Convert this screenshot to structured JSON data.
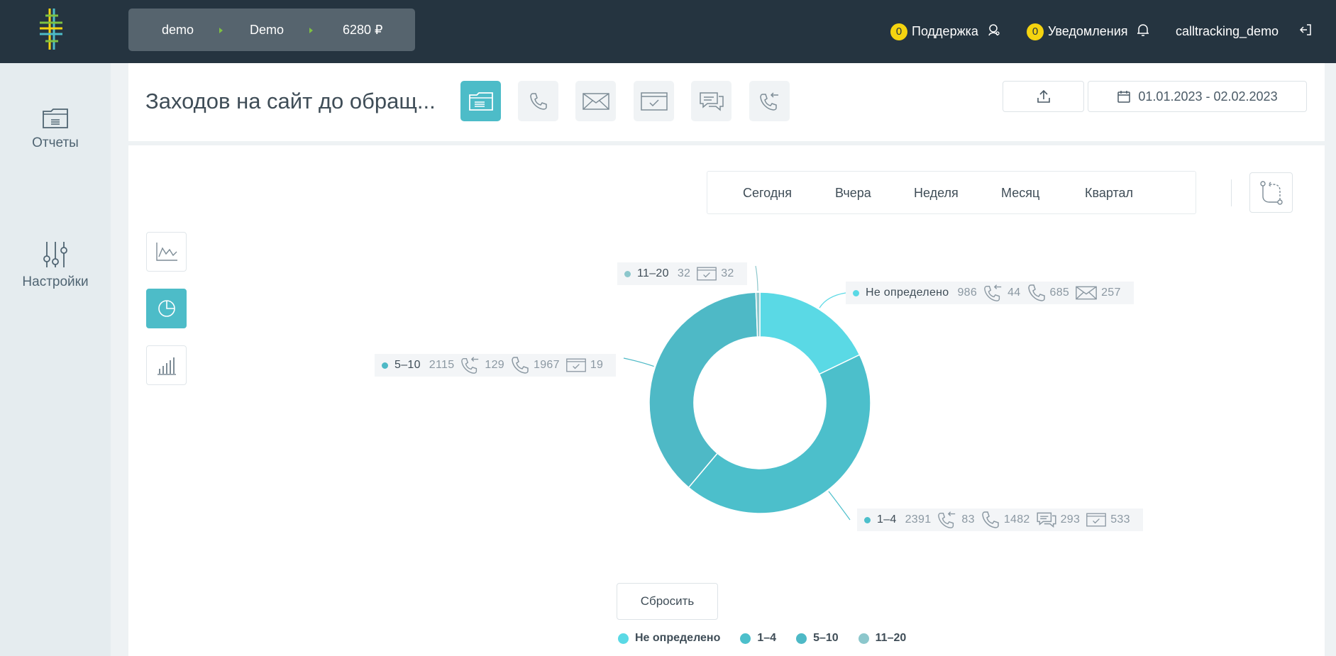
{
  "topbar": {
    "breadcrumbs": [
      "demo",
      "Demo",
      "6280 ₽"
    ],
    "support": {
      "count": "0",
      "label": "Поддержка"
    },
    "notifications": {
      "count": "0",
      "label": "Уведомления"
    },
    "username": "calltracking_demo",
    "colors": {
      "bg": "#253440",
      "badge": "#f5d40f",
      "crumb_sep": "#7ec142"
    }
  },
  "sidebar": {
    "items": [
      {
        "label": "Отчеты",
        "icon": "folder-icon"
      },
      {
        "label": "Настройки",
        "icon": "sliders-icon"
      }
    ]
  },
  "header": {
    "title": "Заходов на сайт до обращ...",
    "type_buttons": [
      "all-requests-icon",
      "phone-icon",
      "mail-icon",
      "form-icon",
      "chat-icon",
      "callback-icon"
    ],
    "date_range": "01.01.2023 - 02.02.2023"
  },
  "periods": [
    "Сегодня",
    "Вчера",
    "Неделя",
    "Месяц",
    "Квартал"
  ],
  "view_buttons": [
    "line-chart-icon",
    "pie-chart-icon",
    "bar-chart-icon"
  ],
  "reset_label": "Сбросить",
  "chart_data": {
    "type": "pie",
    "categories": [
      "Не определено",
      "1–4",
      "5–10",
      "11–20"
    ],
    "values": [
      986,
      2391,
      2115,
      32
    ],
    "colors": [
      "#5ad9e5",
      "#4cbfcb",
      "#4eb9c6",
      "#8cc7cc"
    ],
    "breakdowns": [
      {
        "name": "Не определено",
        "total": "986",
        "items": [
          {
            "icon": "callback-icon",
            "value": "44"
          },
          {
            "icon": "phone-icon",
            "value": "685"
          },
          {
            "icon": "mail-icon",
            "value": "257"
          }
        ]
      },
      {
        "name": "1–4",
        "total": "2391",
        "items": [
          {
            "icon": "callback-icon",
            "value": "83"
          },
          {
            "icon": "phone-icon",
            "value": "1482"
          },
          {
            "icon": "chat-icon",
            "value": "293"
          },
          {
            "icon": "form-icon",
            "value": "533"
          }
        ]
      },
      {
        "name": "5–10",
        "total": "2115",
        "items": [
          {
            "icon": "callback-icon",
            "value": "129"
          },
          {
            "icon": "phone-icon",
            "value": "1967"
          },
          {
            "icon": "form-icon",
            "value": "19"
          }
        ]
      },
      {
        "name": "11–20",
        "total": "32",
        "items": [
          {
            "icon": "form-icon",
            "value": "32"
          }
        ]
      }
    ],
    "legend_placement": "bottom"
  }
}
